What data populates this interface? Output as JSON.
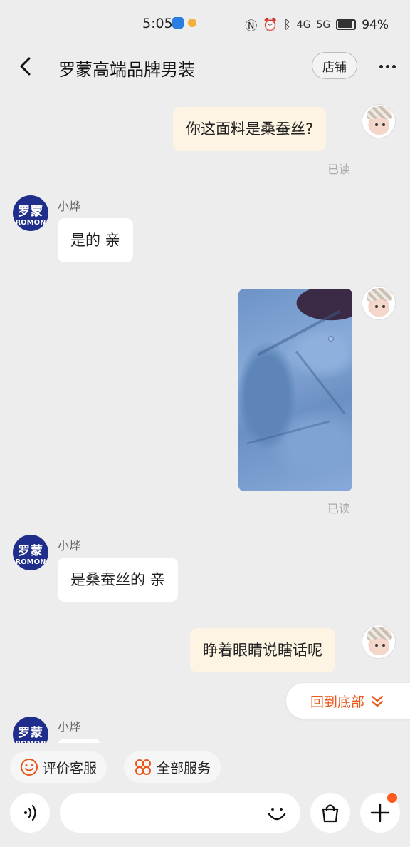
{
  "status_bar": {
    "time": "5:05",
    "network_4g": "4G",
    "network_5g": "5G",
    "battery": "94%"
  },
  "header": {
    "title": "罗蒙高端品牌男装",
    "store_label": "店铺"
  },
  "chat": {
    "shop_avatar_cn": "罗蒙",
    "shop_avatar_en": "ROMON",
    "messages": [
      {
        "from": "user",
        "text": "你这面料是桑蚕丝?",
        "status": "已读"
      },
      {
        "from": "shop",
        "sender": "小烨",
        "text": "是的 亲"
      },
      {
        "from": "user",
        "type": "image",
        "status": "已读"
      },
      {
        "from": "shop",
        "sender": "小烨",
        "text": "是桑蚕丝的 亲"
      },
      {
        "from": "user",
        "text": "睁着眼睛说瞎话呢"
      },
      {
        "from": "shop",
        "sender": "小烨",
        "text": ""
      }
    ],
    "scroll_to_bottom_label": "回到底部"
  },
  "quick_actions": [
    {
      "label": "评价客服",
      "icon": "smile-icon"
    },
    {
      "label": "全部服务",
      "icon": "grid-dots-icon"
    }
  ],
  "input": {
    "placeholder": "",
    "value": ""
  },
  "colors": {
    "accent": "#e8561a",
    "outgoing_bubble": "#fdf4e3",
    "incoming_bubble": "#ffffff",
    "background": "#ededed",
    "shop_avatar": "#1f2e8a"
  }
}
